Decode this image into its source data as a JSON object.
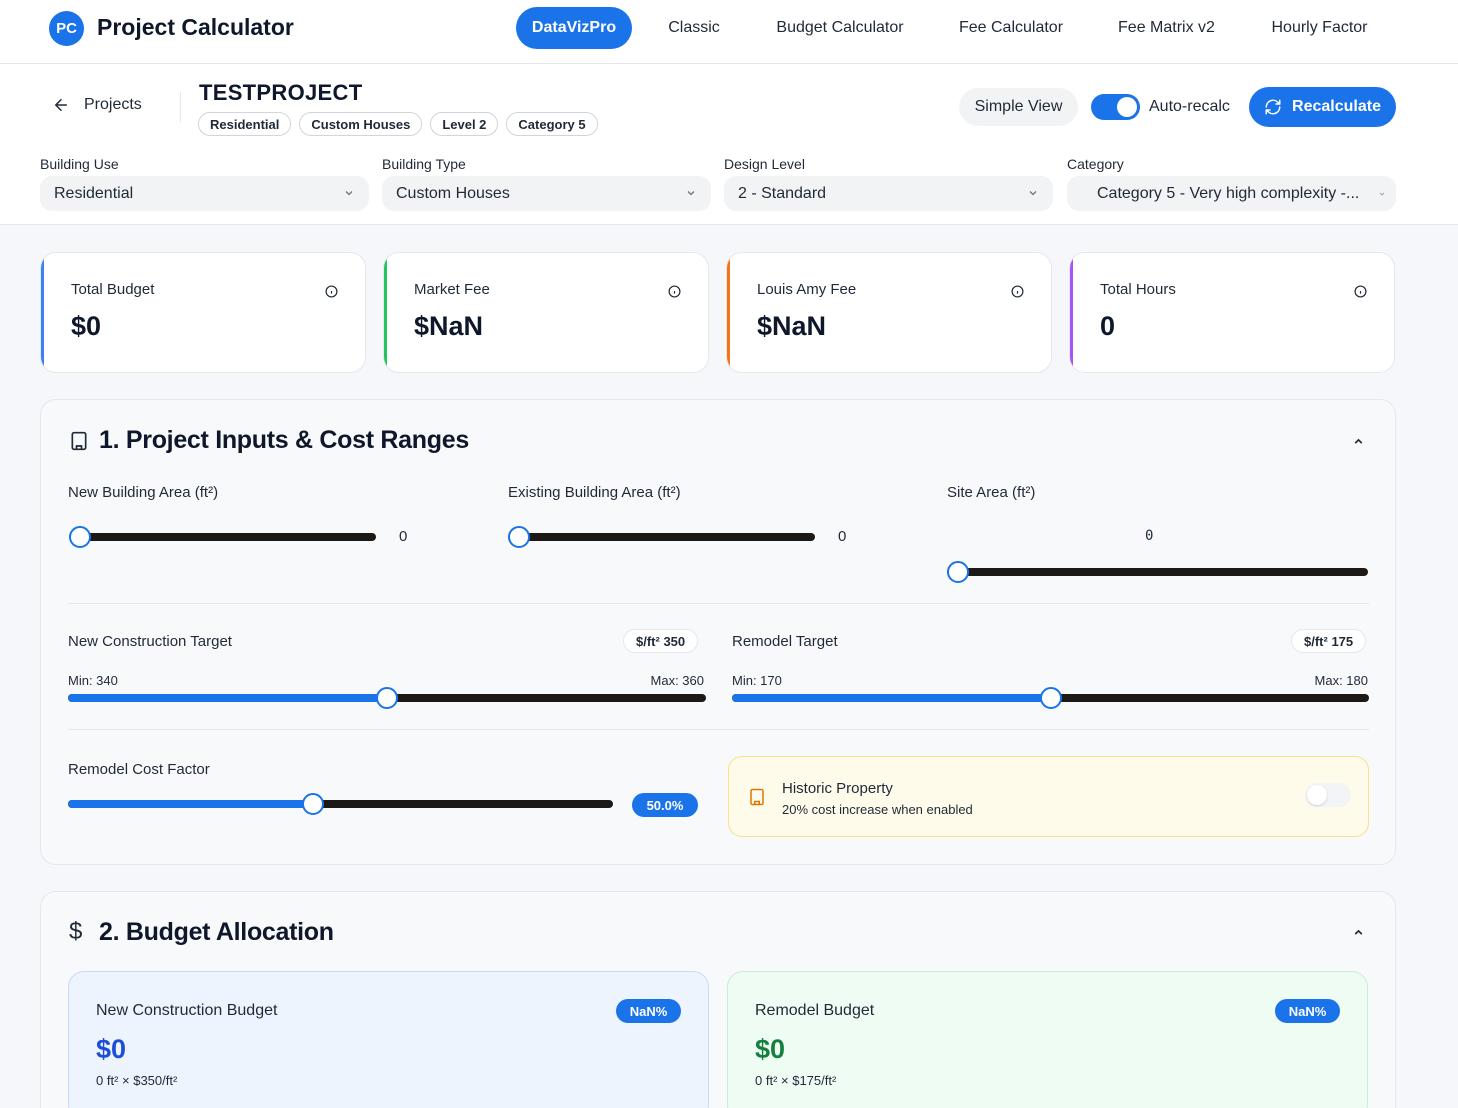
{
  "app": {
    "logo": "PC",
    "title": "Project Calculator"
  },
  "nav": {
    "tabs": [
      "DataVizPro",
      "Classic",
      "Budget Calculator",
      "Fee Calculator",
      "Fee Matrix v2",
      "Hourly Factor"
    ],
    "active": "DataVizPro"
  },
  "header": {
    "back_label": "Projects",
    "project_name": "TESTPROJECT",
    "tags": [
      "Residential",
      "Custom Houses",
      "Level 2",
      "Category 5"
    ],
    "simple_view": "Simple View",
    "auto_recalc_label": "Auto-recalc",
    "auto_recalc_on": true,
    "recalculate": "Recalculate",
    "fields": [
      {
        "label": "Building Use",
        "value": "Residential"
      },
      {
        "label": "Building Type",
        "value": "Custom Houses"
      },
      {
        "label": "Design Level",
        "value": "2 - Standard"
      },
      {
        "label": "Category",
        "value": "Category 5 - Very high complexity -..."
      }
    ]
  },
  "stats": [
    {
      "label": "Total Budget",
      "value": "$0",
      "color": "#3b82f6"
    },
    {
      "label": "Market Fee",
      "value": "$NaN",
      "color": "#22c55e"
    },
    {
      "label": "Louis Amy Fee",
      "value": "$NaN",
      "color": "#f97316"
    },
    {
      "label": "Total Hours",
      "value": "0",
      "color": "#a855f7"
    }
  ],
  "section1": {
    "title": "1. Project Inputs & Cost Ranges",
    "new_building_area": {
      "label": "New Building Area (ft²)",
      "value": "0",
      "fraction": 0
    },
    "existing_building_area": {
      "label": "Existing Building Area (ft²)",
      "value": "0",
      "fraction": 0
    },
    "site_area": {
      "label": "Site Area (ft²)",
      "value": "0",
      "fraction": 0
    },
    "new_construction_target": {
      "label": "New Construction Target",
      "badge": "$/ft² 350",
      "min_label": "Min: 340",
      "max_label": "Max: 360",
      "fraction": 0.5
    },
    "remodel_target": {
      "label": "Remodel Target",
      "badge": "$/ft² 175",
      "min_label": "Min: 170",
      "max_label": "Max: 180",
      "fraction": 0.5
    },
    "remodel_cost_factor": {
      "label": "Remodel Cost Factor",
      "value": "50.0%",
      "fraction": 0.45
    },
    "historic": {
      "title": "Historic Property",
      "subtitle": "20% cost increase when enabled",
      "enabled": false
    }
  },
  "section2": {
    "title": "2. Budget Allocation",
    "new_construction": {
      "title": "New Construction Budget",
      "pct": "NaN%",
      "value": "$0",
      "formula": "0 ft² × $350/ft²",
      "accent": "#1d4ed8"
    },
    "remodel": {
      "title": "Remodel Budget",
      "pct": "NaN%",
      "value": "$0",
      "formula": "0 ft² × $175/ft²",
      "accent": "#15803d"
    }
  }
}
